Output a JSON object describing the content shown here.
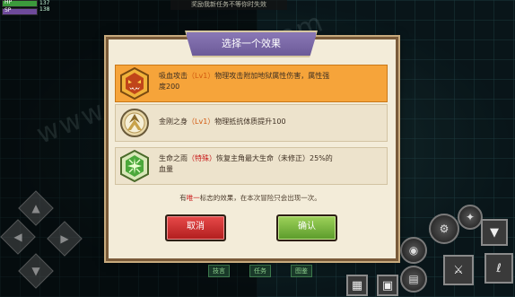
{
  "hud": {
    "hp_label": "HP",
    "sp_label": "SP",
    "hp_value": "137",
    "sp_value": "138"
  },
  "top_hint": "奖励我新任务不等你时失效",
  "watermark": "www.hackhome.com",
  "dialog": {
    "title": "选择一个效果",
    "options": [
      {
        "name": "吸血攻击",
        "level": "（Lv1）",
        "desc_line1": "物理攻击附加地狱属性伤害，属性强",
        "desc_line2": "度200",
        "icon": "vampire-mask-icon",
        "selected": true
      },
      {
        "name": "金刚之身",
        "level": "（Lv1）",
        "desc_line1": "物理抵抗体质提升100",
        "icon": "diamond-body-icon",
        "selected": false
      },
      {
        "name": "生命之雨",
        "tag": "（特殊）",
        "desc_line1": "恢复主角最大生命（未修正）25%的",
        "desc_line2": "血量",
        "icon": "life-rain-icon",
        "selected": false
      }
    ],
    "footer_prefix": "有",
    "footer_highlight": "唯一",
    "footer_suffix": "标志的效果，在本次冒险只会出现一次。",
    "cancel_label": "取消",
    "confirm_label": "确认"
  },
  "bottom_tabs": [
    "技言",
    "任务",
    "图鉴"
  ],
  "colors": {
    "selected_option": "#f6a43a",
    "cancel": "#c82a2a",
    "confirm": "#7ab43a",
    "title_banner": "#7c68a8"
  }
}
